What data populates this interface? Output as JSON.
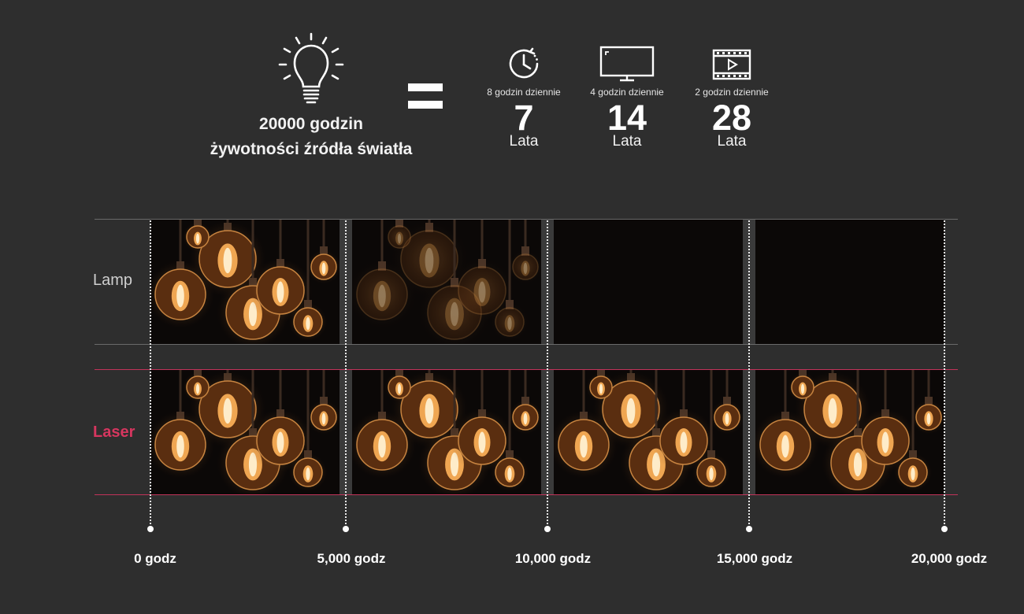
{
  "header": {
    "hours_line1": "20000 godzin",
    "hours_line2": "żywotności źródła światła",
    "equivalents": [
      {
        "icon": "clock-icon",
        "usage": "8 godzin dziennie",
        "years": "7",
        "unit": "Lata"
      },
      {
        "icon": "monitor-icon",
        "usage": "4 godzin dziennie",
        "years": "14",
        "unit": "Lata"
      },
      {
        "icon": "film-icon",
        "usage": "2 godzin dziennie",
        "years": "28",
        "unit": "Lata"
      }
    ]
  },
  "rows": {
    "lamp": {
      "label": "Lamp",
      "brightness": [
        1.0,
        0.3,
        0.0,
        0.0
      ]
    },
    "laser": {
      "label": "Laser",
      "brightness": [
        1.0,
        1.0,
        1.0,
        1.0
      ]
    }
  },
  "timeline": {
    "ticks": [
      "0 godz",
      "5,000 godz",
      "10,000 godz",
      "15,000 godz",
      "20,000 godz"
    ]
  },
  "colors": {
    "background": "#2e2e2e",
    "laser_accent": "#d6365f",
    "bulb_glow": "#ffb45a"
  }
}
